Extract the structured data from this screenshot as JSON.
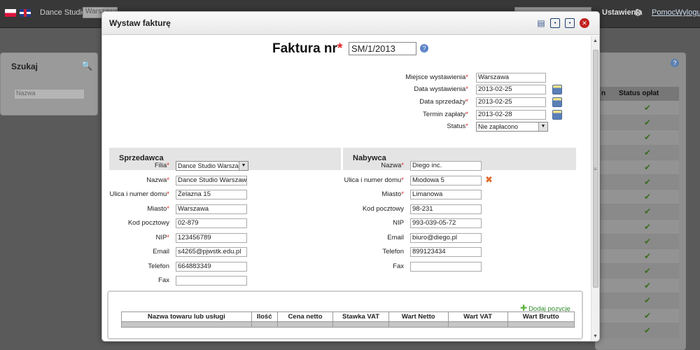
{
  "background": {
    "app_name": "Dance Studio",
    "branch_select": "Warszawa",
    "settings_label": "Ustawienia",
    "help_link": "Pomoc",
    "logout_link": "Wyloguj",
    "search_title": "Szukaj",
    "search_placeholder": "Nazwa",
    "table_header_status": "Status opłat",
    "table_header_n": "n",
    "row_count": 16
  },
  "modal": {
    "title": "Wystaw fakturę",
    "icons": [
      "filter-icon",
      "save-icon",
      "save-close-icon",
      "close-icon"
    ],
    "invoice_label": "Faktura nr",
    "invoice_number": "SM/1/2013",
    "meta": {
      "place_label": "Miejsce wystawienia",
      "place_value": "Warszawa",
      "issue_date_label": "Data wystawienia",
      "issue_date_value": "2013-02-25",
      "sale_date_label": "Data sprzedaży",
      "sale_date_value": "2013-02-25",
      "due_date_label": "Termin zapłaty",
      "due_date_value": "2013-02-28",
      "status_label": "Status",
      "status_value": "Nie zapłacono"
    },
    "seller": {
      "heading": "Sprzedawca",
      "branch_label": "Filia",
      "branch_value": "Dance Studio Warsza",
      "name_label": "Nazwa",
      "name_value": "Dance Studio Warszawa",
      "street_label": "Ulica i numer domu",
      "street_value": "Żelazna 15",
      "city_label": "Miasto",
      "city_value": "Warszawa",
      "zip_label": "Kod pocztowy",
      "zip_value": "02-879",
      "nip_label": "NIP",
      "nip_value": "123456789",
      "email_label": "Email",
      "email_value": "s4265@pjwstk.edu.pl",
      "phone_label": "Telefon",
      "phone_value": "664883349",
      "fax_label": "Fax",
      "fax_value": ""
    },
    "buyer": {
      "heading": "Nabywca",
      "name_label": "Nazwa",
      "name_value": "Diego inc.",
      "street_label": "Ulica i numer domu",
      "street_value": "Miodowa 5",
      "city_label": "Miasto",
      "city_value": "Limanowa",
      "zip_label": "Kod pocztowy",
      "zip_value": "98-231",
      "nip_label": "NIP",
      "nip_value": "993-039-05-72",
      "email_label": "Email",
      "email_value": "biuro@diego.pl",
      "phone_label": "Telefon",
      "phone_value": "899123434",
      "fax_label": "Fax",
      "fax_value": ""
    },
    "products": {
      "add_label": "Dodaj pozycję",
      "columns": [
        "Nazwa towaru lub usługi",
        "Ilość",
        "Cena netto",
        "Stawka VAT",
        "Wart Netto",
        "Wart VAT",
        "Wart Brutto"
      ]
    }
  }
}
